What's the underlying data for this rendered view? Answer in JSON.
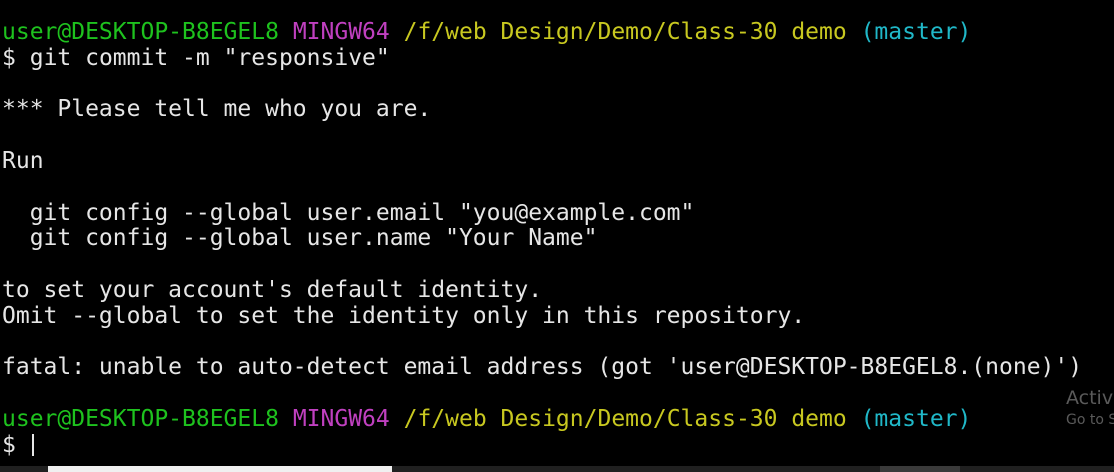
{
  "prompt": {
    "user_host": "user@DESKTOP-B8EGEL8",
    "env": "MINGW64",
    "path": "/f/web Design/Demo/Class-30 demo",
    "branch": "(master)",
    "symbol": "$"
  },
  "command": "git commit -m \"responsive\"",
  "output": [
    "",
    "*** Please tell me who you are.",
    "",
    "Run",
    "",
    "  git config --global user.email \"you@example.com\"",
    "  git config --global user.name \"Your Name\"",
    "",
    "to set your account's default identity.",
    "Omit --global to set the identity only in this repository.",
    "",
    "fatal: unable to auto-detect email address (got 'user@DESKTOP-B8EGEL8.(none)')",
    ""
  ],
  "watermark": {
    "line1": "Activate Windows",
    "line2": "Go to Settings to activate Windows."
  },
  "colors": {
    "background": "#000000",
    "text": "#e6e6e6",
    "user_host": "#1ec21e",
    "env": "#c040c0",
    "path": "#c8c820",
    "branch": "#20b8c8"
  }
}
